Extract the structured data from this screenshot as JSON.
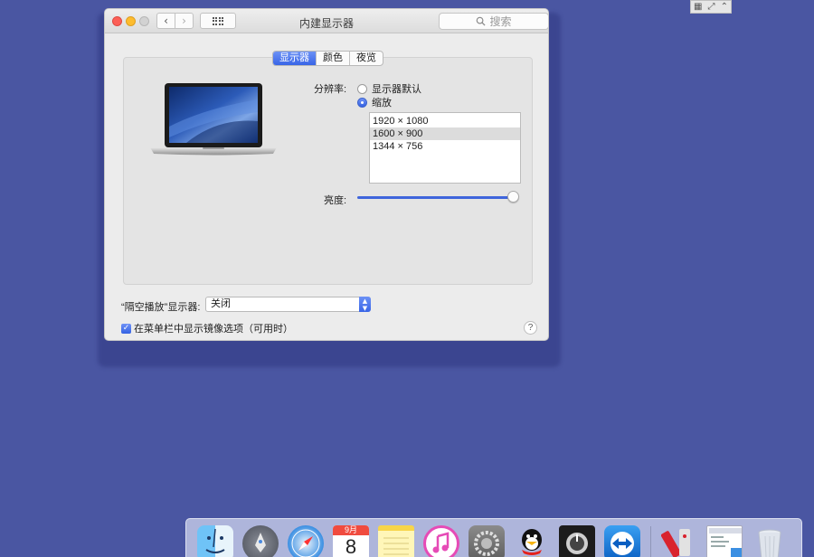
{
  "window": {
    "title": "内建显示器",
    "search_placeholder": "搜索"
  },
  "tabs": [
    {
      "label": "显示器",
      "active": true
    },
    {
      "label": "颜色",
      "active": false
    },
    {
      "label": "夜览",
      "active": false
    }
  ],
  "resolution": {
    "label": "分辨率:",
    "options": [
      {
        "label": "显示器默认",
        "selected": false
      },
      {
        "label": "缩放",
        "selected": true
      }
    ],
    "list": [
      "1920 × 1080",
      "1600 × 900",
      "1344 × 756"
    ],
    "list_selected": "1600 × 900"
  },
  "brightness": {
    "label": "亮度:",
    "value_fraction": 0.97
  },
  "airplay": {
    "label": "“隔空播放”显示器:",
    "value": "关闭"
  },
  "mirroring": {
    "label": "在菜单栏中显示镜像选项（可用时）",
    "checked": true
  },
  "help_label": "?",
  "dock": {
    "calendar_month": "9月",
    "calendar_day": "8",
    "items": [
      "finder-icon",
      "launchpad-icon",
      "safari-icon",
      "calendar-icon",
      "notes-icon",
      "itunes-icon",
      "system-preferences-icon",
      "qq-icon",
      "logic-icon",
      "teamviewer-icon",
      "app-icon",
      "preview-window-icon",
      "trash-icon"
    ]
  },
  "colors": {
    "desktop": "#4a56a2",
    "accent": "#3865e7"
  }
}
